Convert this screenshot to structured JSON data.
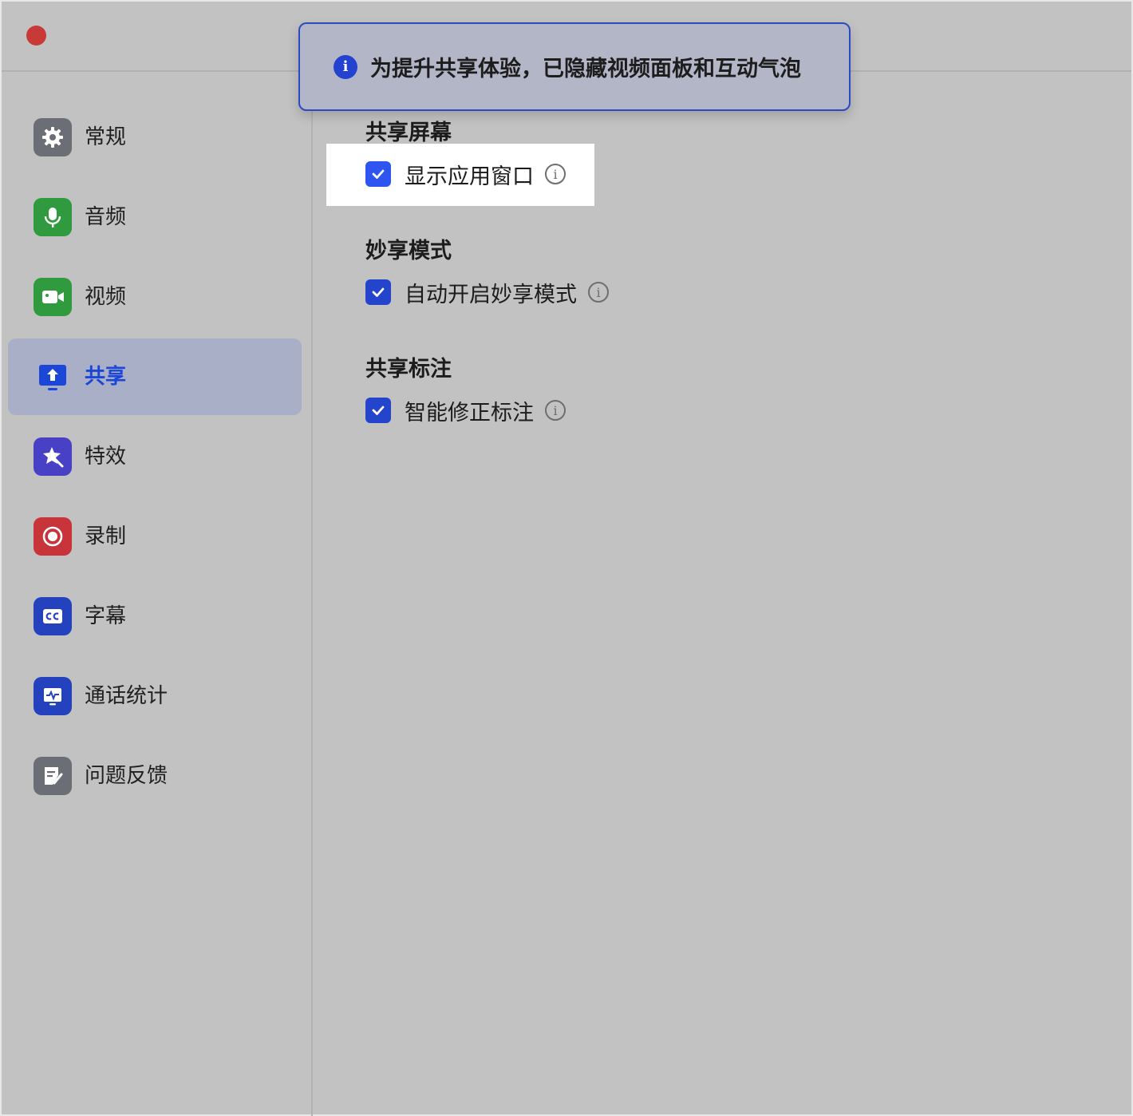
{
  "toast": {
    "icon": "info-icon",
    "message": "为提升共享体验，已隐藏视频面板和互动气泡"
  },
  "sidebar": {
    "items": [
      {
        "label": "常规",
        "icon": "gear-icon",
        "color": "#6b6e75",
        "active": false
      },
      {
        "label": "音频",
        "icon": "microphone-icon",
        "color": "#2f9a3e",
        "active": false
      },
      {
        "label": "视频",
        "icon": "camera-icon",
        "color": "#2f9a3e",
        "active": false
      },
      {
        "label": "共享",
        "icon": "screen-share-icon",
        "color": "#1b46d8",
        "active": true
      },
      {
        "label": "特效",
        "icon": "sparkle-icon",
        "color": "#4841c6",
        "active": false
      },
      {
        "label": "录制",
        "icon": "record-icon",
        "color": "#c7343a",
        "active": false
      },
      {
        "label": "字幕",
        "icon": "closed-caption-icon",
        "color": "#2442be",
        "active": false
      },
      {
        "label": "通话统计",
        "icon": "stats-icon",
        "color": "#2442be",
        "active": false
      },
      {
        "label": "问题反馈",
        "icon": "feedback-icon",
        "color": "#6b6e75",
        "active": false
      }
    ]
  },
  "main": {
    "sections": [
      {
        "title": "共享屏幕",
        "option": {
          "label": "显示应用窗口",
          "checked": true
        }
      },
      {
        "title": "妙享模式",
        "option": {
          "label": "自动开启妙享模式",
          "checked": true
        }
      },
      {
        "title": "共享标注",
        "option": {
          "label": "智能修正标注",
          "checked": true
        }
      }
    ],
    "info_glyph": "i",
    "check_icon": "checkmark-icon"
  },
  "colors": {
    "accent": "#1b46d8",
    "checkbox": "#2544cc",
    "overlay": "#c2c2c2",
    "close_button": "#c83a38"
  }
}
